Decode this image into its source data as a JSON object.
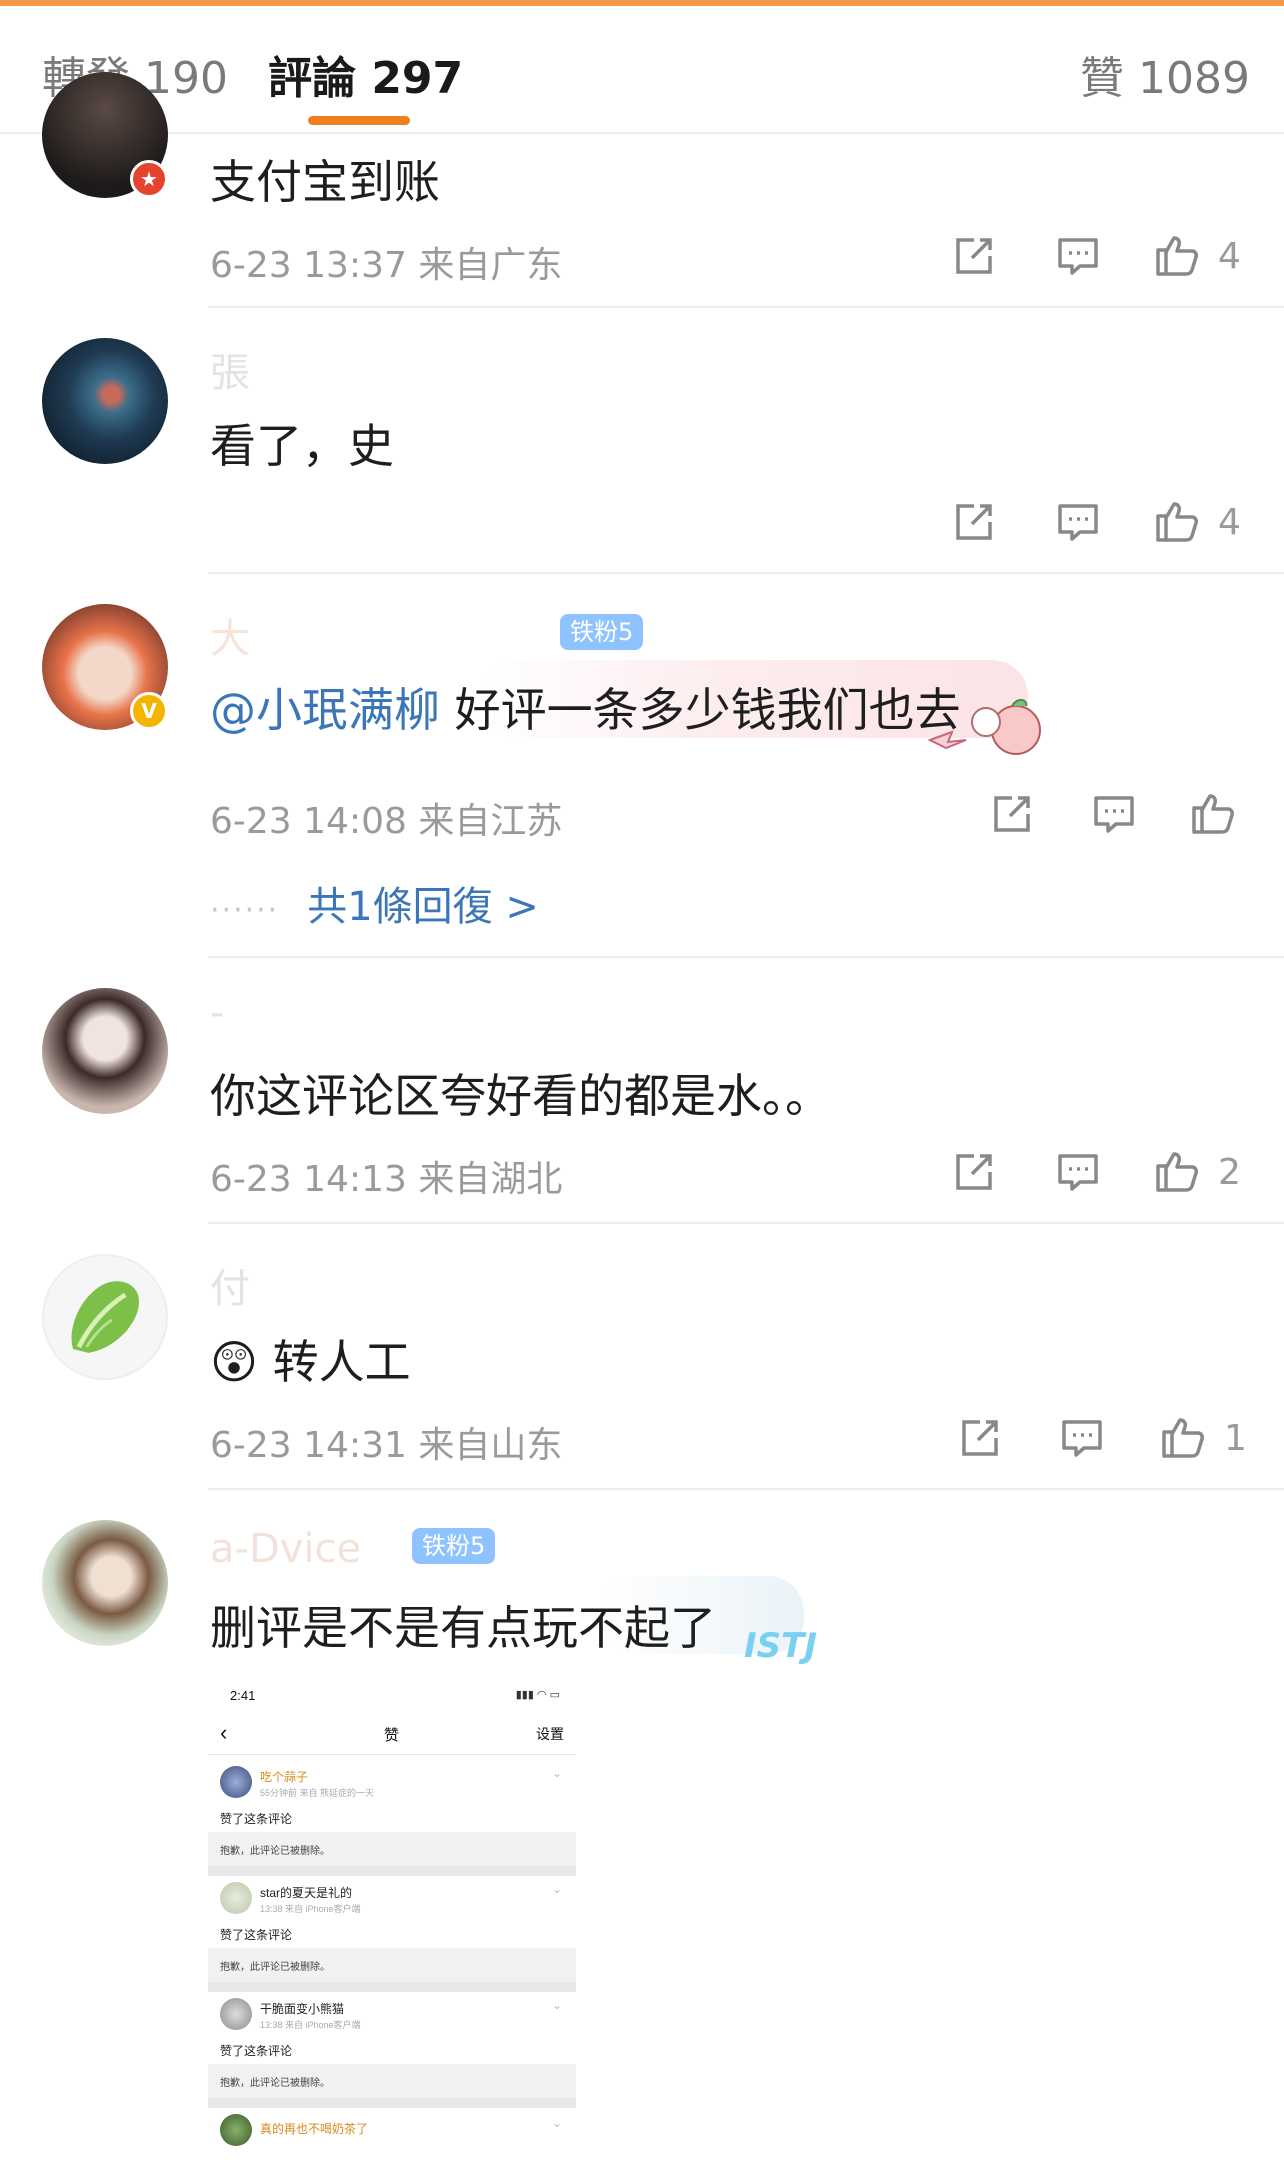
{
  "tabs": {
    "repost": "轉發 190",
    "comments": "評論 297",
    "likes": "贊 1089"
  },
  "comments": [
    {
      "text": "支付宝到账",
      "meta": "6-23 13:37 来自广东",
      "likes": "4"
    },
    {
      "username": "張",
      "text": "看了，史",
      "likes": "4"
    },
    {
      "fan_badge": "铁粉5",
      "mention": "@小珉满柳",
      "text": "好评一条多少钱我们也去",
      "meta": "6-23 14:08 来自江苏",
      "replies": "共1條回復 >"
    },
    {
      "text": "你这评论区夸好看的都是水。。",
      "meta": "6-23 14:13 来自湖北",
      "likes": "2"
    },
    {
      "emoji": "😲",
      "text": "转人工",
      "meta": "6-23 14:31 来自山东",
      "likes": "1"
    },
    {
      "username": "a-Dvice",
      "fan_badge": "铁粉5",
      "text": "删评是不是有点玩不起了",
      "bubble_tag": "ISTJ"
    }
  ],
  "screenshot": {
    "time": "2:41",
    "title": "赞",
    "settings": "设置",
    "items": [
      {
        "name": "吃个蒜子",
        "time": "55分钟前  来自 熊延症的一天",
        "action": "赞了这条评论",
        "deleted": "抱歉，此评论已被删除。"
      },
      {
        "name": "star的夏天是礼的",
        "time": "13:38  来自 iPhone客户端",
        "action": "赞了这条评论",
        "deleted": "抱歉，此评论已被删除。"
      },
      {
        "name": "干脆面变小熊猫",
        "time": "13:38  来自 iPhone客户端",
        "action": "赞了这条评论",
        "deleted": "抱歉，此评论已被删除。"
      },
      {
        "name": "真的再也不喝奶茶了"
      }
    ]
  },
  "colors": {
    "accent": "#f07f1e",
    "link": "#3b76b8",
    "meta": "#9a9a9a"
  }
}
